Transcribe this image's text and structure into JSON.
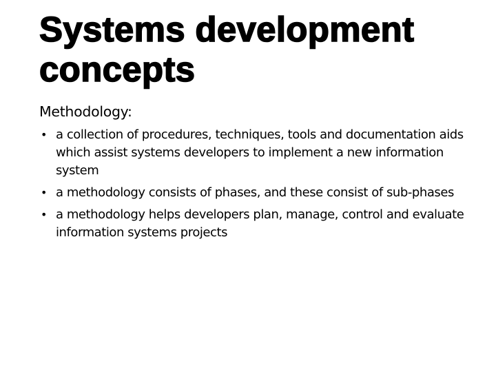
{
  "slide": {
    "title": "Systems development concepts",
    "subheading": "Methodology:",
    "bullet_glyph": "•",
    "bullets": [
      "a collection of procedures, techniques, tools  and documentation aids which assist systems developers to implement a new information system",
      "a methodology consists of phases, and these consist of sub-phases",
      "a methodology helps developers plan, manage, control and evaluate information systems projects"
    ]
  }
}
